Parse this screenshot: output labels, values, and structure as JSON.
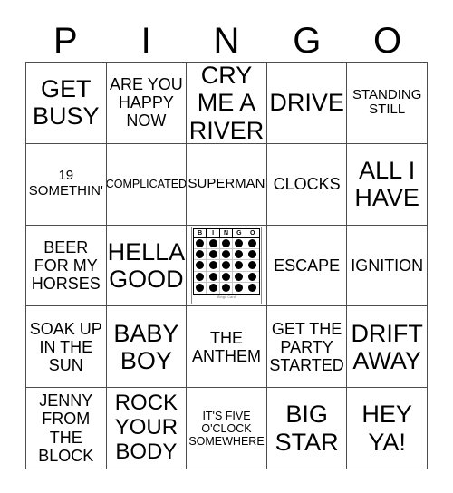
{
  "card": {
    "header_letters": [
      "P",
      "I",
      "N",
      "G",
      "O"
    ],
    "rows": [
      [
        {
          "text": "GET\nBUSY",
          "size": "sz-xl"
        },
        {
          "text": "ARE YOU\nHAPPY\nNOW",
          "size": "sz-md"
        },
        {
          "text": "CRY\nME A\nRIVER",
          "size": "sz-xl"
        },
        {
          "text": "DRIVE",
          "size": "sz-xl"
        },
        {
          "text": "STANDING\nSTILL",
          "size": "sz-sm"
        }
      ],
      [
        {
          "text": "19\nSOMETHIN'",
          "size": "sz-sm"
        },
        {
          "text": "COMPLICATED",
          "size": "sz-xs"
        },
        {
          "text": "SUPERMAN",
          "size": "sz-sm"
        },
        {
          "text": "CLOCKS",
          "size": "sz-md"
        },
        {
          "text": "ALL I\nHAVE",
          "size": "sz-xl"
        }
      ],
      [
        {
          "text": "BEER\nFOR MY\nHORSES",
          "size": "sz-md"
        },
        {
          "text": "HELLA\nGOOD",
          "size": "sz-xl"
        },
        {
          "type": "free-space",
          "mini_card": {
            "header_letters": [
              "B",
              "I",
              "N",
              "G",
              "O"
            ],
            "dot_rows": 5,
            "dot_cols": 5,
            "caption": "Bingo Card"
          }
        },
        {
          "text": "ESCAPE",
          "size": "sz-md"
        },
        {
          "text": "IGNITION",
          "size": "sz-md"
        }
      ],
      [
        {
          "text": "SOAK UP\nIN THE\nSUN",
          "size": "sz-md"
        },
        {
          "text": "BABY\nBOY",
          "size": "sz-xl"
        },
        {
          "text": "THE\nANTHEM",
          "size": "sz-md"
        },
        {
          "text": "GET THE\nPARTY\nSTARTED",
          "size": "sz-md"
        },
        {
          "text": "DRIFT\nAWAY",
          "size": "sz-xl"
        }
      ],
      [
        {
          "text": "JENNY\nFROM\nTHE\nBLOCK",
          "size": "sz-md"
        },
        {
          "text": "ROCK\nYOUR\nBODY",
          "size": "sz-lg"
        },
        {
          "text": "IT'S FIVE\nO'CLOCK\nSOMEWHERE",
          "size": "sz-xs"
        },
        {
          "text": "BIG\nSTAR",
          "size": "sz-xl"
        },
        {
          "text": "HEY\nYA!",
          "size": "sz-xl"
        }
      ]
    ],
    "colors": {
      "background": "#ffffff",
      "text": "#000000",
      "grid_line": "#4d4d4d",
      "dot": "#000000"
    }
  }
}
